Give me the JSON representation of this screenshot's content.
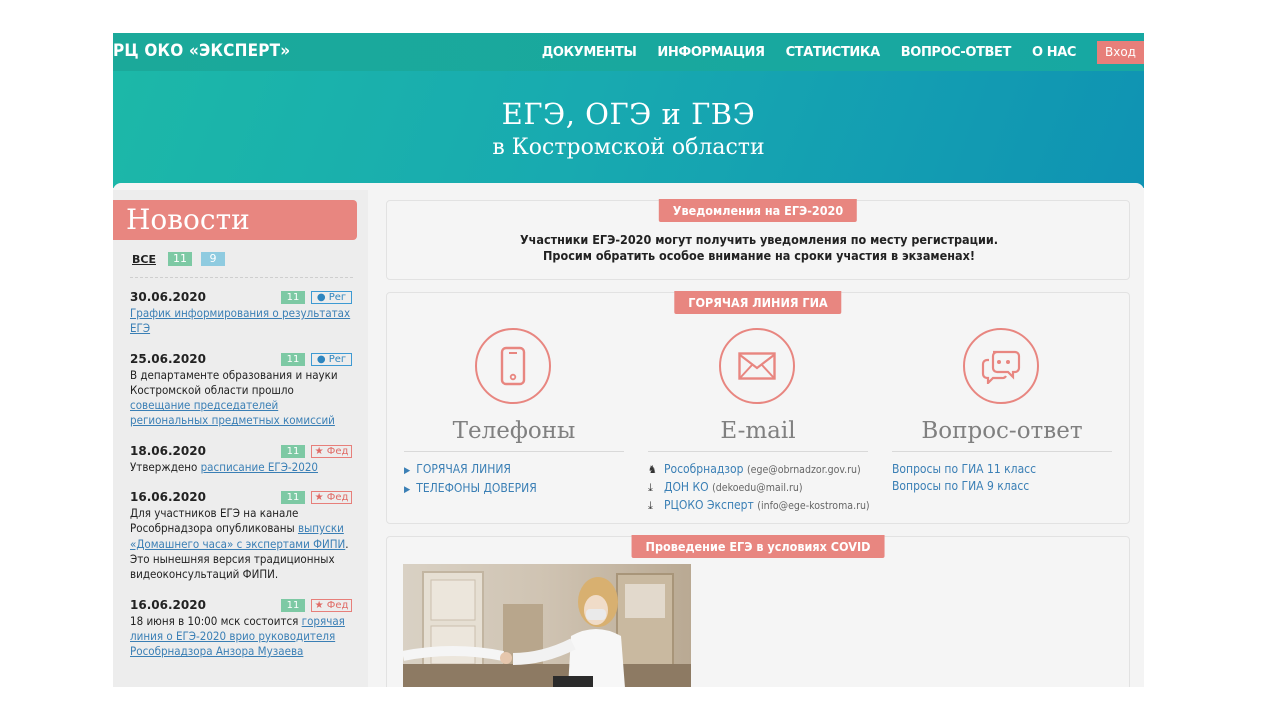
{
  "header": {
    "brand": "РЦ ОКО «ЭКСПЕРТ»",
    "nav": [
      "ДОКУМЕНТЫ",
      "ИНФОРМАЦИЯ",
      "СТАТИСТИКА",
      "ВОПРОС-ОТВЕТ",
      "О НАС"
    ],
    "login": "Вход"
  },
  "hero": {
    "title": "ЕГЭ, ОГЭ и ГВЭ",
    "subtitle": "в Костромской области"
  },
  "sidebar": {
    "title": "Новости",
    "filters": {
      "all": "ВСЕ",
      "grade11": "11",
      "grade9": "9"
    },
    "news": [
      {
        "date": "30.06.2020",
        "grade": "11",
        "tag": "● Рег",
        "text_before": "",
        "link": "График информирования о результатах ЕГЭ",
        "text_after": ""
      },
      {
        "date": "25.06.2020",
        "grade": "11",
        "tag": "● Рег",
        "text_before": "В департаменте образования и науки Костромской области прошло ",
        "link": "совещание председателей региональных предметных комиссий",
        "text_after": ""
      },
      {
        "date": "18.06.2020",
        "grade": "11",
        "tag": "★ Фед",
        "text_before": "Утверждено ",
        "link": "расписание ЕГЭ-2020",
        "text_after": ""
      },
      {
        "date": "16.06.2020",
        "grade": "11",
        "tag": "★ Фед",
        "text_before": "Для участников ЕГЭ на канале Рособрнадзора опубликованы ",
        "link": "выпуски «Домашнего часа» с экспертами ФИПИ",
        "text_after": ". Это нынешняя версия традиционных видеоконсультаций ФИПИ."
      },
      {
        "date": "16.06.2020",
        "grade": "11",
        "tag": "★ Фед",
        "text_before": "18 июня в 10:00 мск состоится ",
        "link": "горячая линия о ЕГЭ-2020 врио руководителя Рособрнадзора Анзора Музаева",
        "text_after": ""
      }
    ]
  },
  "main": {
    "notice": {
      "label": "Уведомления на ЕГЭ-2020",
      "line1": "Участники ЕГЭ-2020 могут получить уведомления по месту регистрации.",
      "line2": "Просим обратить особое внимание на сроки участия в экзаменах!"
    },
    "hotline": {
      "label": "ГОРЯЧАЯ ЛИНИЯ ГИА",
      "phones": {
        "title": "Телефоны",
        "links": [
          "ГОРЯЧАЯ ЛИНИЯ",
          "ТЕЛЕФОНЫ ДОВЕРИЯ"
        ]
      },
      "email": {
        "title": "E-mail",
        "links": [
          {
            "name": "Рособрнадзор",
            "addr": "(ege@obrnadzor.gov.ru)"
          },
          {
            "name": "ДОН КО",
            "addr": "(dekoedu@mail.ru)"
          },
          {
            "name": "РЦОКО Эксперт",
            "addr": "(info@ege-kostroma.ru)"
          }
        ]
      },
      "qa": {
        "title": "Вопрос-ответ",
        "links": [
          "Вопросы по ГИА 11 класс",
          "Вопросы по ГИА 9 класс"
        ]
      }
    },
    "covid": {
      "label": "Проведение ЕГЭ в условиях COVID"
    }
  },
  "colors": {
    "teal": "#17a8a2",
    "accent": "#e88680",
    "link": "#3a7fb5"
  },
  "icons": [
    "phone-icon",
    "envelope-icon",
    "chat-bubbles-icon",
    "eagle-icon",
    "download-icon"
  ]
}
